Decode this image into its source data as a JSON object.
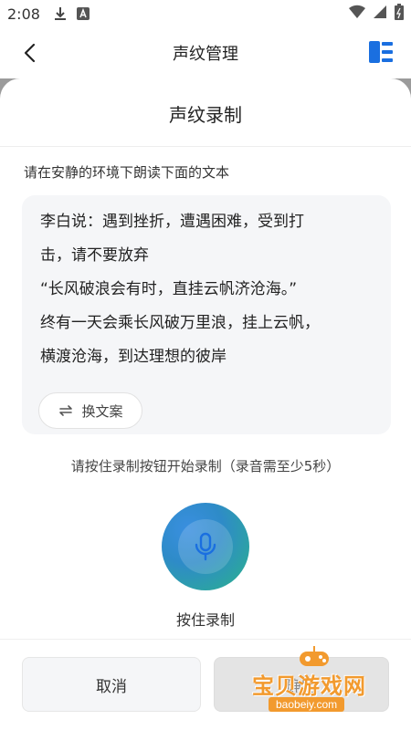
{
  "status_bar": {
    "time": "2:08",
    "icons": [
      "download-icon",
      "text-a-icon",
      "wifi-icon",
      "signal-icon",
      "battery-icon"
    ]
  },
  "header": {
    "title": "声纹管理",
    "back_icon": "chevron-left-icon",
    "right_icon": "list-icon",
    "accent_color": "#1a6fe0"
  },
  "sheet": {
    "title": "声纹录制",
    "instruction": "请在安静的环境下朗读下面的文本",
    "text_lines": [
      "李白说：遇到挫折，遭遇困难，受到打",
      "击，请不要放弃",
      "“长风破浪会有时，直挂云帆济沧海。”",
      "终有一天会乘长风破万里浪，挂上云帆，",
      "横渡沧海，到达理想的彼岸"
    ],
    "swap_button": "换文案",
    "hint": "请按住录制按钮开始录制（录音需至少5秒）",
    "record_label": "按住录制",
    "cancel_button": "取消",
    "confirm_button": "确定"
  },
  "watermark": {
    "main": "宝贝游戏网",
    "sub": "baobeiy.com"
  }
}
